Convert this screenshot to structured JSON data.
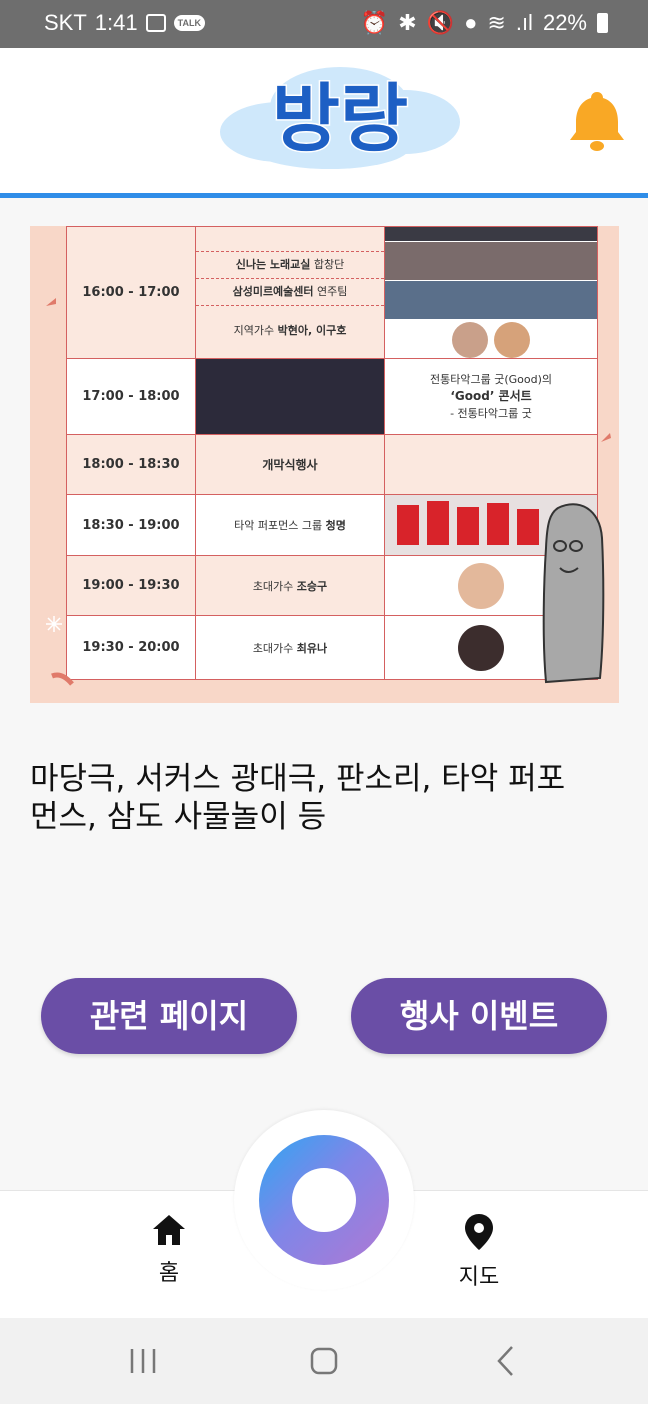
{
  "status_bar": {
    "carrier": "SKT",
    "time": "1:41",
    "battery": "22%"
  },
  "header": {
    "logo_text": "방랑"
  },
  "poster": {
    "rows": [
      {
        "time": "16:00 - 17:00",
        "programs": [
          {
            "name": "신나는 노래교실",
            "suffix": " 합창단"
          },
          {
            "name": "삼성미르예술센터",
            "suffix": " 연주팀"
          },
          {
            "prefix": "지역가수 ",
            "name": "박현아, 이구호"
          }
        ]
      },
      {
        "time": "17:00 - 18:00",
        "info_line1": "전통타악그룹 굿(Good)의",
        "info_line2": "‘Good’ 콘서트",
        "info_line3": "- 전통타악그룹 굿"
      },
      {
        "time": "18:00 - 18:30",
        "program": "개막식행사"
      },
      {
        "time": "18:30 - 19:00",
        "prefix": "타악 퍼포먼스 그룹 ",
        "name": "청명"
      },
      {
        "time": "19:00 - 19:30",
        "prefix": "초대가수 ",
        "name": "조승구"
      },
      {
        "time": "19:30 - 20:00",
        "prefix": "초대가수 ",
        "name": "최유나"
      }
    ]
  },
  "description": "마당극, 서커스 광대극, 판소리, 타악 퍼포먼스, 삼도 사물놀이 등",
  "buttons": {
    "related_page": "관련 페이지",
    "event": "행사 이벤트"
  },
  "bottom_nav": {
    "home": "홈",
    "map": "지도"
  },
  "colors": {
    "accent_purple": "#6a4ea6",
    "header_line": "#2f8de8",
    "bell": "#f9a825"
  }
}
